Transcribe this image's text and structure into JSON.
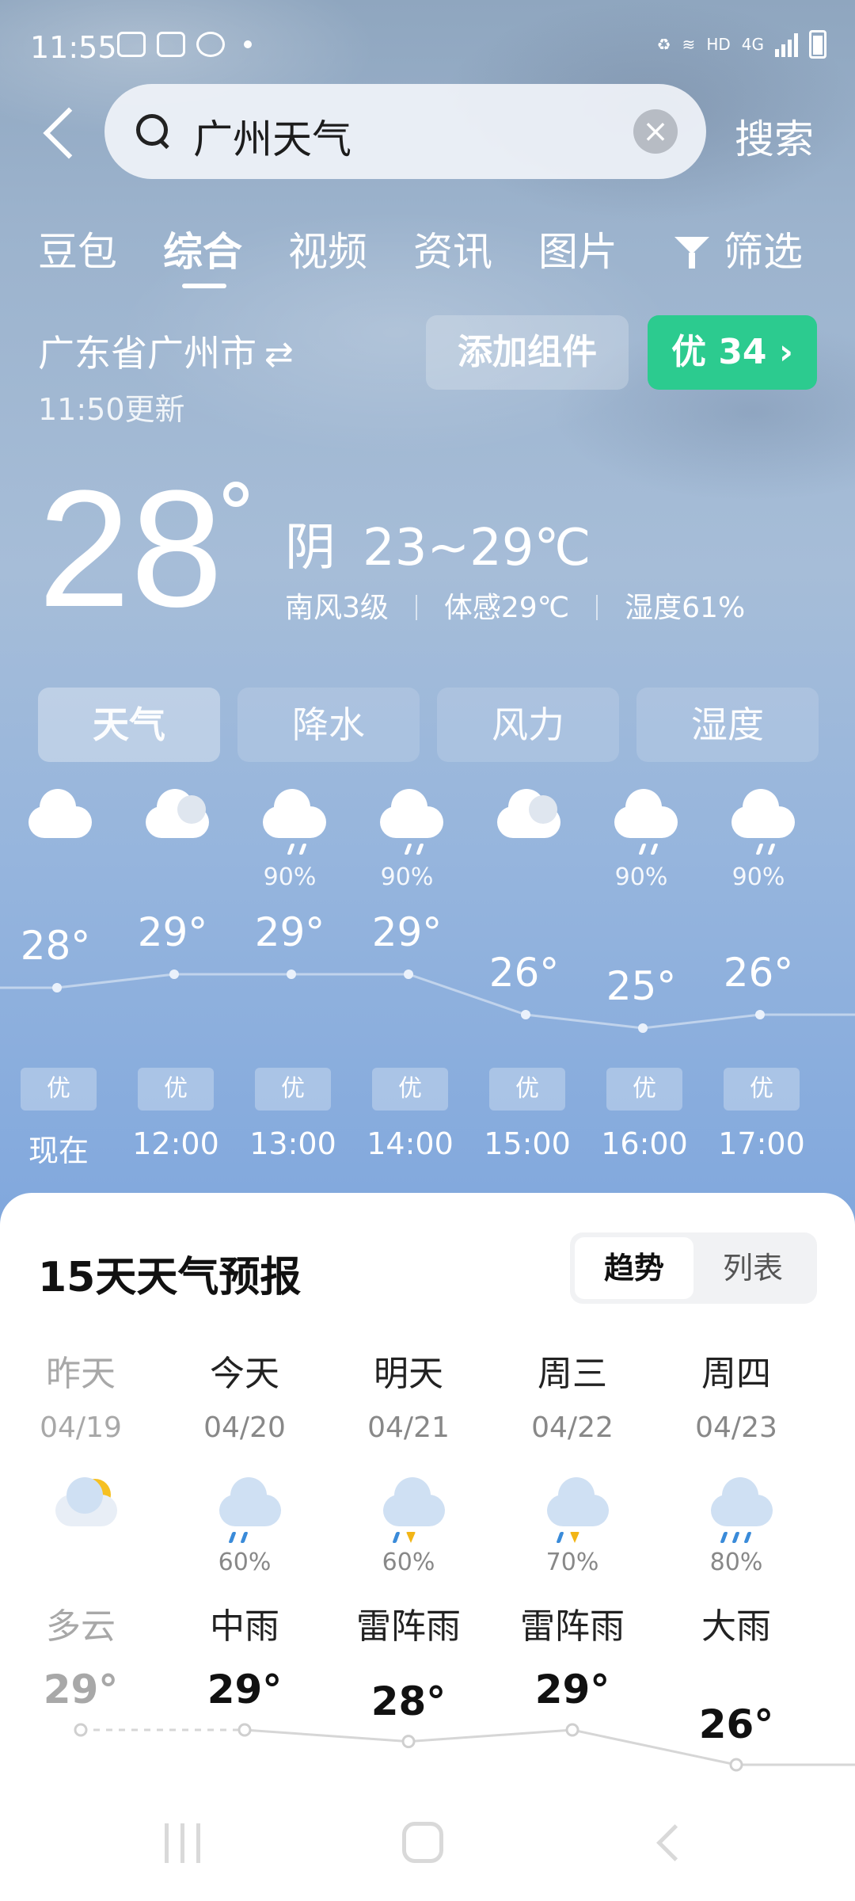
{
  "status_bar": {
    "time": "11:55",
    "network": "4G",
    "hd": "HD"
  },
  "search": {
    "query": "广州天气",
    "button_label": "搜索"
  },
  "tabs": [
    "豆包",
    "综合",
    "视频",
    "资讯",
    "图片"
  ],
  "active_tab": "综合",
  "filter_label": "筛选",
  "location": {
    "name": "广东省广州市",
    "updated": "11:50更新"
  },
  "add_widget_label": "添加组件",
  "aqi": {
    "label": "优 34 ›",
    "color": "#2ccb8f"
  },
  "current": {
    "temp": "28",
    "condition": "阴",
    "range": "23~29℃",
    "wind": "南风3级",
    "feels_like": "体感29℃",
    "humidity": "湿度61%"
  },
  "segments": [
    "天气",
    "降水",
    "风力",
    "湿度"
  ],
  "active_segment": "天气",
  "hourly": [
    {
      "time": "现在",
      "temp": "28°",
      "temp_value": 28,
      "icon": "cloud-icon",
      "precip": "",
      "aq": "优"
    },
    {
      "time": "12:00",
      "temp": "29°",
      "temp_value": 29,
      "icon": "cloudy-icon",
      "precip": "",
      "aq": "优"
    },
    {
      "time": "13:00",
      "temp": "29°",
      "temp_value": 29,
      "icon": "rain-icon",
      "precip": "90%",
      "aq": "优"
    },
    {
      "time": "14:00",
      "temp": "29°",
      "temp_value": 29,
      "icon": "rain-icon",
      "precip": "90%",
      "aq": "优"
    },
    {
      "time": "15:00",
      "temp": "26°",
      "temp_value": 26,
      "icon": "cloudy-icon",
      "precip": "",
      "aq": "优"
    },
    {
      "time": "16:00",
      "temp": "25°",
      "temp_value": 25,
      "icon": "rain-icon",
      "precip": "90%",
      "aq": "优"
    },
    {
      "time": "17:00",
      "temp": "26°",
      "temp_value": 26,
      "icon": "rain-icon",
      "precip": "90%",
      "aq": "优"
    }
  ],
  "forecast": {
    "title": "15天天气预报",
    "toggle": [
      "趋势",
      "列表"
    ],
    "days": [
      {
        "day": "昨天",
        "date": "04/19",
        "icon": "partly-cloudy-icon",
        "precip": "",
        "condition": "多云",
        "high": "29°",
        "high_value": 29,
        "past": true
      },
      {
        "day": "今天",
        "date": "04/20",
        "icon": "rain-icon",
        "precip": "60%",
        "condition": "中雨",
        "high": "29°",
        "high_value": 29,
        "past": false
      },
      {
        "day": "明天",
        "date": "04/21",
        "icon": "thunderstorm-icon",
        "precip": "60%",
        "condition": "雷阵雨",
        "high": "28°",
        "high_value": 28,
        "past": false
      },
      {
        "day": "周三",
        "date": "04/22",
        "icon": "thunderstorm-icon",
        "precip": "70%",
        "condition": "雷阵雨",
        "high": "29°",
        "high_value": 29,
        "past": false
      },
      {
        "day": "周四",
        "date": "04/23",
        "icon": "heavy-rain-icon",
        "precip": "80%",
        "condition": "大雨",
        "high": "26°",
        "high_value": 26,
        "past": false
      }
    ]
  }
}
